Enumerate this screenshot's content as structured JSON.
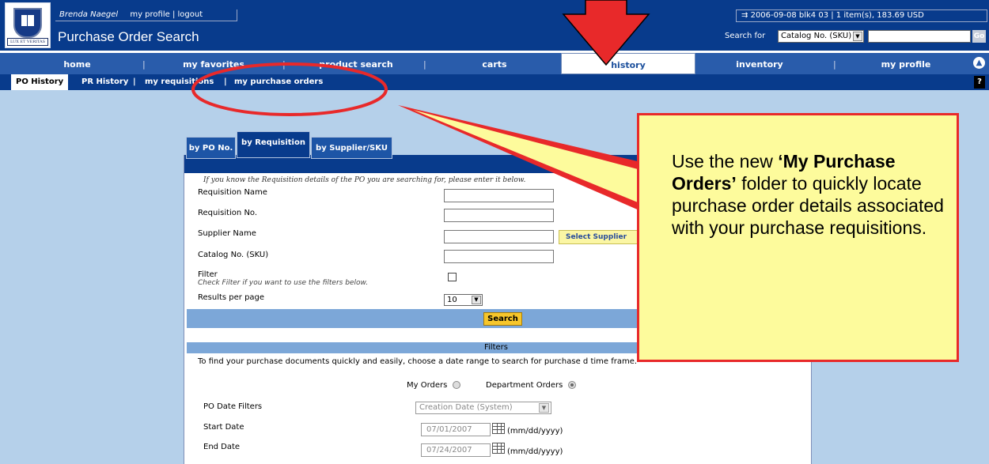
{
  "header": {
    "user_name": "Brenda Naegel",
    "my_profile": "my profile",
    "separator": "|",
    "logout": "logout",
    "page_title": "Purchase Order Search",
    "logo_motto": "LUX ET VERITAS",
    "cart_info": "2006-09-08 blk4 03 | 1 item(s), 183.69 USD",
    "search_label": "Search for",
    "search_option": "Catalog No. (SKU)",
    "go_label": "Go"
  },
  "nav": {
    "items": [
      "home",
      "my favorites",
      "product search",
      "carts",
      "history",
      "inventory",
      "my profile"
    ],
    "active": "history"
  },
  "subnav": {
    "items": [
      "PO History",
      "PR History",
      "my requisitions",
      "my purchase orders"
    ],
    "separator": "|",
    "help": "?"
  },
  "tabs": [
    "by PO No.",
    "by Requisition",
    "by Supplier/SKU"
  ],
  "form": {
    "intro": "If you know the Requisition details of the PO you are searching for, please enter it below.",
    "requisition_name": "Requisition Name",
    "requisition_no": "Requisition No.",
    "supplier_name": "Supplier Name",
    "select_supplier": "Select Supplier",
    "catalog_no": "Catalog No. (SKU)",
    "filter": "Filter",
    "filter_hint": "Check Filter if you want to use the filters below.",
    "results_per_page": "Results per page",
    "results_value": "10",
    "search_button": "Search"
  },
  "filters": {
    "heading": "Filters",
    "description": "To find your purchase documents quickly and easily, choose a date range to search for purchase d                                    time frame.",
    "my_orders": "My Orders",
    "department_orders": "Department Orders",
    "po_date_filters": "PO Date Filters",
    "po_date_option": "Creation Date (System)",
    "start_date_label": "Start Date",
    "start_date": "07/01/2007",
    "end_date_label": "End Date",
    "end_date": "07/24/2007",
    "date_format": "(mm/dd/yyyy)"
  },
  "callout": {
    "line_prefix": "Use the new ",
    "highlight": "‘My Purchase Orders’",
    "line_suffix": " folder to quickly locate purchase order details associated with your purchase requisitions."
  },
  "colors": {
    "header_blue": "#083b8c",
    "nav_blue": "#295cab",
    "content_bg": "#b5d0ea",
    "annotation_red": "#e8292a",
    "callout_yellow": "#fdfb9c"
  }
}
